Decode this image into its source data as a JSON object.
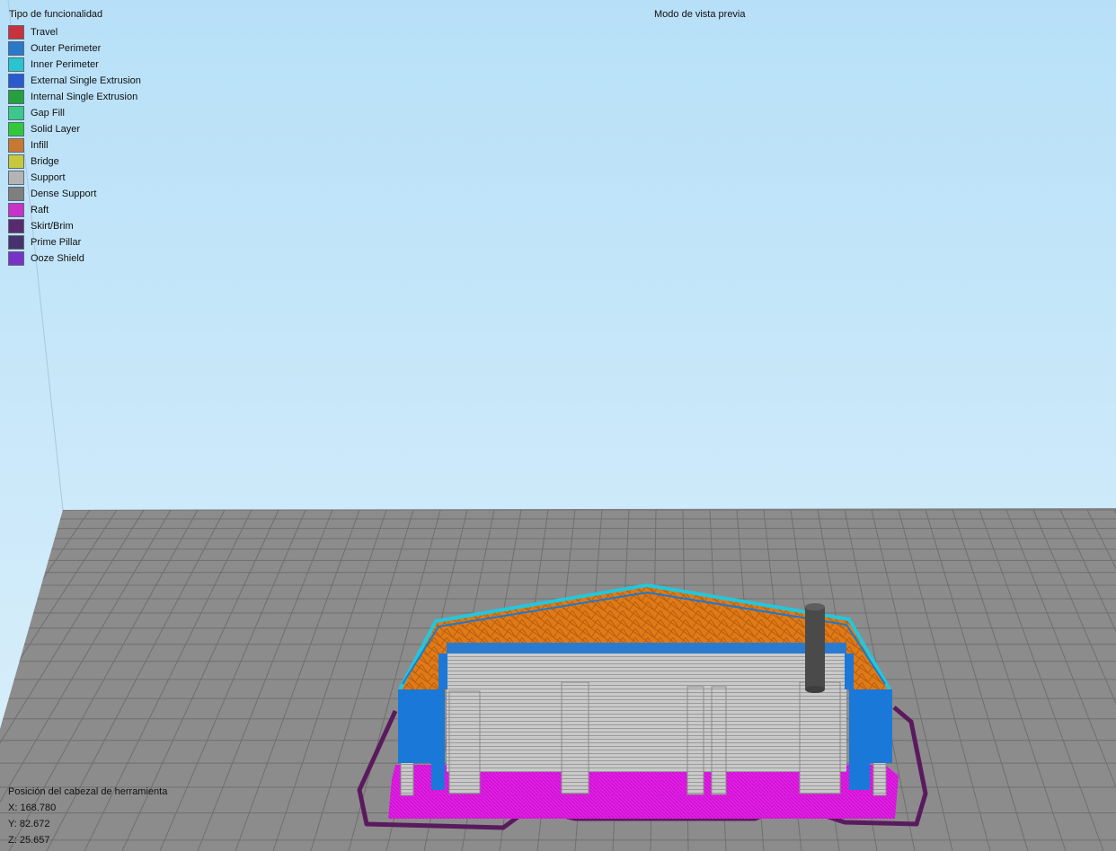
{
  "viewport": {
    "legend_title": "Tipo de funcionalidad",
    "preview_mode": "Modo de vista previa"
  },
  "legend": {
    "items": [
      {
        "label": "Travel",
        "color": "#c8323c"
      },
      {
        "label": "Outer Perimeter",
        "color": "#2a78c8"
      },
      {
        "label": "Inner Perimeter",
        "color": "#2ac3d0"
      },
      {
        "label": "External Single Extrusion",
        "color": "#2a5ad0"
      },
      {
        "label": "Internal Single Extrusion",
        "color": "#25a03c"
      },
      {
        "label": "Gap Fill",
        "color": "#3cc88c"
      },
      {
        "label": "Solid Layer",
        "color": "#32c83c"
      },
      {
        "label": "Infill",
        "color": "#c87832"
      },
      {
        "label": "Bridge",
        "color": "#c8c83c"
      },
      {
        "label": "Support",
        "color": "#b4b4b4"
      },
      {
        "label": "Dense Support",
        "color": "#7f7f7f"
      },
      {
        "label": "Raft",
        "color": "#c832c8"
      },
      {
        "label": "Skirt/Brim",
        "color": "#5a2a6e"
      },
      {
        "label": "Prime Pillar",
        "color": "#46326e"
      },
      {
        "label": "Ooze Shield",
        "color": "#7832c8"
      }
    ]
  },
  "toolhead": {
    "title": "Posición del cabezal de herramienta",
    "x": "X: 168.780",
    "y": "Y: 82.672",
    "z": "Z: 25.657"
  },
  "colors": {
    "sky_top": "#bfe4f8",
    "sky_bottom": "#d8eefb",
    "bed": "#8a8a8a",
    "grid": "#6e6e6e"
  }
}
